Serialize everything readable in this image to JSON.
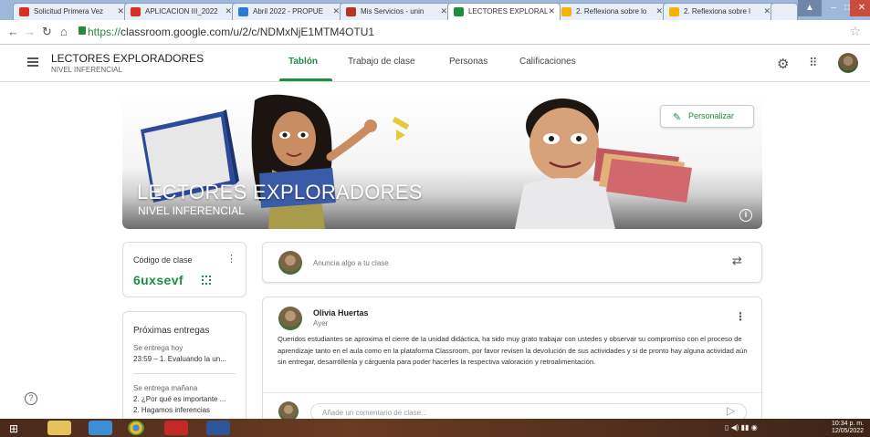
{
  "browser": {
    "tabs": [
      {
        "label": "Solicitud Primera Vez",
        "fav": "#d93025"
      },
      {
        "label": "APLICACION III_2022",
        "fav": "#d93025"
      },
      {
        "label": "Abril 2022 - PROPUE",
        "fav": "#2a7ad5"
      },
      {
        "label": "Mis Servicios - unin",
        "fav": "#b5361f"
      },
      {
        "label": "LECTORES EXPLORAL",
        "fav": "#1e8e3e"
      },
      {
        "label": "2. Reflexiona sobre lo",
        "fav": "#f4b400"
      },
      {
        "label": "2. Reflexiona sobre l",
        "fav": "#f4b400"
      }
    ],
    "url_scheme": "https://",
    "url_rest": "classroom.google.com/u/2/c/NDMxNjE1MTM4OTU1"
  },
  "header": {
    "class_name": "LECTORES EXPLORADORES",
    "class_section": "NIVEL INFERENCIAL",
    "tabs": [
      "Tablón",
      "Trabajo de clase",
      "Personas",
      "Calificaciones"
    ]
  },
  "banner": {
    "title": "LECTORES EXPLORADORES",
    "subtitle": "NIVEL INFERENCIAL",
    "customize_label": "Personalizar"
  },
  "class_code": {
    "label": "Código de clase",
    "value": "6uxsevf"
  },
  "upcoming": {
    "title": "Próximas entregas",
    "groups": [
      {
        "when": "Se entrega hoy",
        "items": [
          "23:59 – 1. Evaluando la un..."
        ]
      },
      {
        "when": "Se entrega mañana",
        "items": [
          "2. ¿Por qué es importante ...",
          "2. Hagamos inferencias"
        ]
      }
    ]
  },
  "stream": {
    "announce_placeholder": "Anuncia algo a tu clase",
    "post": {
      "author": "Olivia Huertas",
      "time": "Ayer",
      "body": "Queridos estudiantes se aproxima el cierre de la unidad didáctica, ha sido muy grato trabajar con ustedes y observar su compromiso con el proceso de aprendizaje tanto en el aula como  en la plataforma Classroom, por favor revisen la devolución de sus actividades y si de pronto hay alguna actividad aún sin entregar, desarróllenla y cárguenla para poder hacerles la respectiva valoración y retroalimentación.",
      "comment_placeholder": "Añade un comentario de clase..."
    }
  },
  "taskbar": {
    "time": "10:34 p. m.",
    "date": "12/05/2022"
  },
  "colors": {
    "accent": "#1e8e3e"
  }
}
